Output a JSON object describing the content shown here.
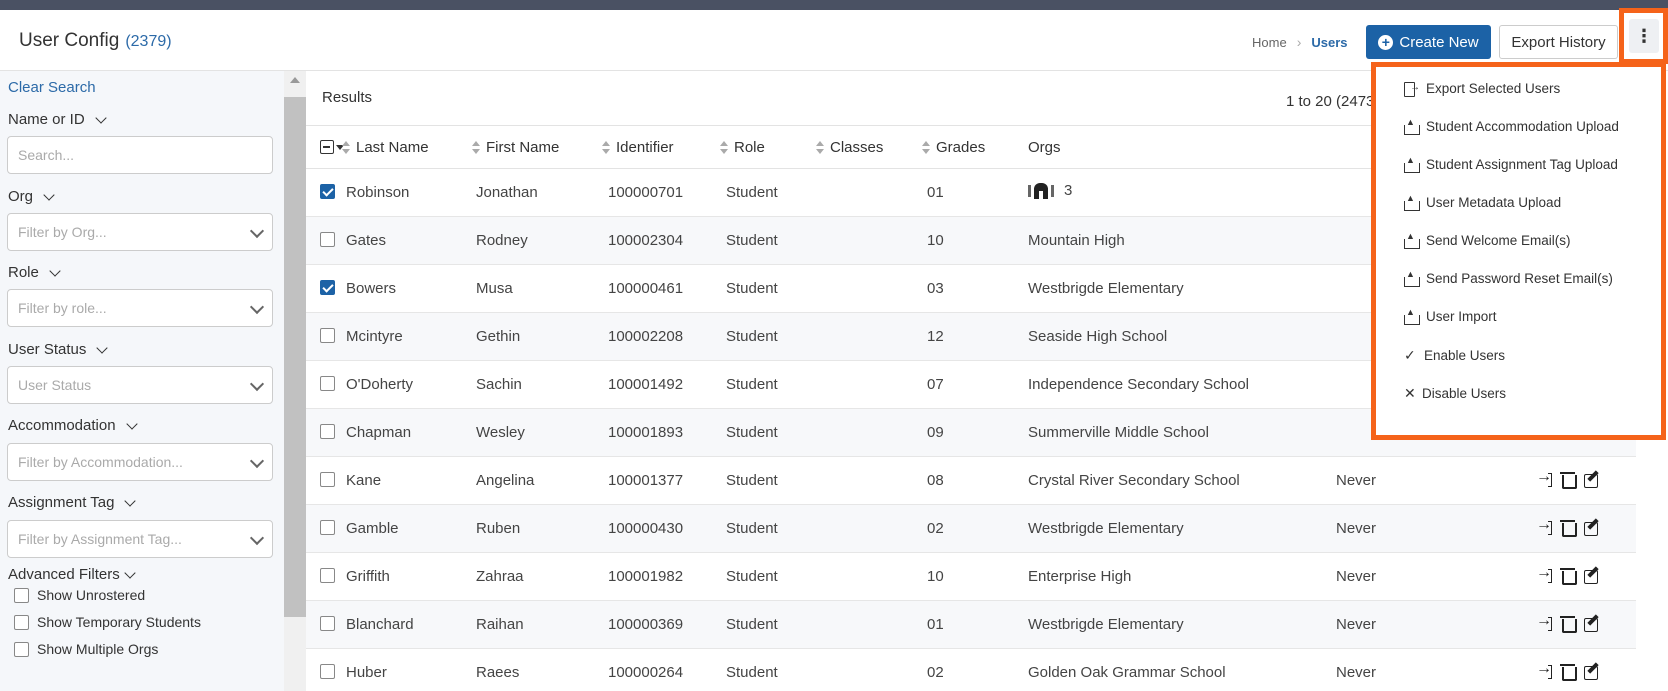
{
  "header": {
    "title": "User Config",
    "count": "(2379)",
    "breadcrumb": {
      "home": "Home",
      "current": "Users"
    },
    "create_label": "Create New",
    "export_history_label": "Export History",
    "more_label": "⋮"
  },
  "sidebar": {
    "clear_search": "Clear Search",
    "filters": [
      {
        "label": "Name or ID",
        "placeholder": "Search..."
      },
      {
        "label": "Org",
        "placeholder": "Filter by Org..."
      },
      {
        "label": "Role",
        "placeholder": "Filter by role..."
      },
      {
        "label": "User Status",
        "placeholder": "User Status"
      },
      {
        "label": "Accommodation",
        "placeholder": "Filter by Accommodation..."
      },
      {
        "label": "Assignment Tag",
        "placeholder": "Filter by Assignment Tag..."
      }
    ],
    "advanced_filters": "Advanced Filters",
    "checkboxes": [
      "Show Unrostered",
      "Show Temporary Students",
      "Show Multiple Orgs"
    ]
  },
  "results": {
    "label": "Results",
    "range": "1 to 20 (2473"
  },
  "table": {
    "columns": [
      "Last Name",
      "First Name",
      "Identifier",
      "Role",
      "Classes",
      "Grades",
      "Orgs"
    ],
    "rows": [
      {
        "checked": true,
        "last": "Robinson",
        "first": "Jonathan",
        "id": "100000701",
        "role": "Student",
        "classes": "",
        "grade": "01",
        "org": "3",
        "org_icon": true,
        "last_login": "",
        "actions": false
      },
      {
        "checked": false,
        "last": "Gates",
        "first": "Rodney",
        "id": "100002304",
        "role": "Student",
        "classes": "",
        "grade": "10",
        "org": "Mountain High",
        "last_login": "",
        "actions": false
      },
      {
        "checked": true,
        "last": "Bowers",
        "first": "Musa",
        "id": "100000461",
        "role": "Student",
        "classes": "",
        "grade": "03",
        "org": "Westbrigde Elementary",
        "last_login": "",
        "actions": false
      },
      {
        "checked": false,
        "last": "Mcintyre",
        "first": "Gethin",
        "id": "100002208",
        "role": "Student",
        "classes": "",
        "grade": "12",
        "org": "Seaside High School",
        "last_login": "",
        "actions": false
      },
      {
        "checked": false,
        "last": "O'Doherty",
        "first": "Sachin",
        "id": "100001492",
        "role": "Student",
        "classes": "",
        "grade": "07",
        "org": "Independence Secondary School",
        "last_login": "",
        "actions": false
      },
      {
        "checked": false,
        "last": "Chapman",
        "first": "Wesley",
        "id": "100001893",
        "role": "Student",
        "classes": "",
        "grade": "09",
        "org": "Summerville Middle School",
        "last_login": "",
        "actions": false
      },
      {
        "checked": false,
        "last": "Kane",
        "first": "Angelina",
        "id": "100001377",
        "role": "Student",
        "classes": "",
        "grade": "08",
        "org": "Crystal River Secondary School",
        "last_login": "Never",
        "actions": true
      },
      {
        "checked": false,
        "last": "Gamble",
        "first": "Ruben",
        "id": "100000430",
        "role": "Student",
        "classes": "",
        "grade": "02",
        "org": "Westbrigde Elementary",
        "last_login": "Never",
        "actions": true
      },
      {
        "checked": false,
        "last": "Griffith",
        "first": "Zahraa",
        "id": "100001982",
        "role": "Student",
        "classes": "",
        "grade": "10",
        "org": "Enterprise High",
        "last_login": "Never",
        "actions": true
      },
      {
        "checked": false,
        "last": "Blanchard",
        "first": "Raihan",
        "id": "100000369",
        "role": "Student",
        "classes": "",
        "grade": "01",
        "org": "Westbrigde Elementary",
        "last_login": "Never",
        "actions": true
      },
      {
        "checked": false,
        "last": "Huber",
        "first": "Raees",
        "id": "100000264",
        "role": "Student",
        "classes": "",
        "grade": "02",
        "org": "Golden Oak Grammar School",
        "last_login": "Never",
        "actions": true
      }
    ]
  },
  "menu": {
    "items": [
      {
        "label": "Export Selected Users",
        "icon": "export-icon"
      },
      {
        "label": "Student Accommodation Upload",
        "icon": "upload-icon"
      },
      {
        "label": "Student Assignment Tag Upload",
        "icon": "upload-icon"
      },
      {
        "label": "User Metadata Upload",
        "icon": "upload-icon"
      },
      {
        "label": "Send Welcome Email(s)",
        "icon": "upload-icon"
      },
      {
        "label": "Send Password Reset Email(s)",
        "icon": "upload-icon"
      },
      {
        "label": "User Import",
        "icon": "upload-icon"
      },
      {
        "label": "Enable Users",
        "icon": "check-icon"
      },
      {
        "label": "Disable Users",
        "icon": "x-icon"
      }
    ]
  },
  "colors": {
    "accent": "#1c62a6",
    "highlight": "#f5631a",
    "link": "#2c6aa8"
  }
}
